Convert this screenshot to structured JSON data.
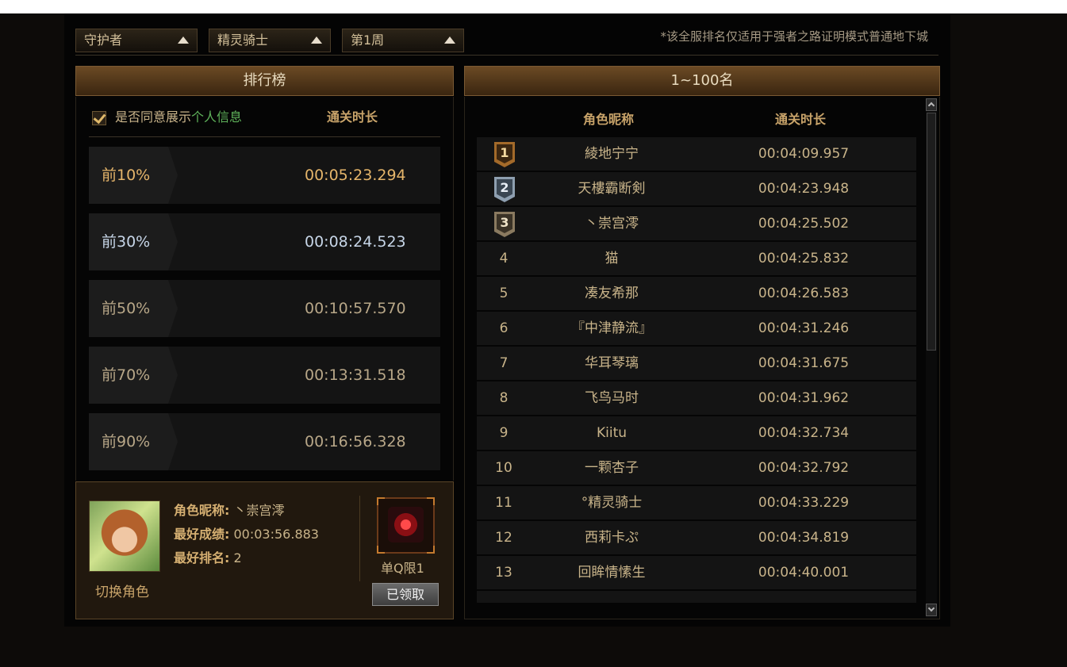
{
  "filters": {
    "class": "守护者",
    "subclass": "精灵骑士",
    "week": "第1周"
  },
  "notice": "*该全服排名仅适用于强者之路证明模式普通地下城",
  "left_panel": {
    "title": "排行榜",
    "agree_prefix": "是否同意展示",
    "agree_link": "个人信息",
    "agree_checked": true,
    "time_header": "通关时长",
    "percentiles": [
      {
        "label": "前10%",
        "time": "00:05:23.294",
        "color": "#e5b56a"
      },
      {
        "label": "前30%",
        "time": "00:08:24.523",
        "color": "#c7d6e8"
      },
      {
        "label": "前50%",
        "time": "00:10:57.570",
        "color": "#b8a788"
      },
      {
        "label": "前70%",
        "time": "00:13:31.518",
        "color": "#b8a788"
      },
      {
        "label": "前90%",
        "time": "00:16:56.328",
        "color": "#b8a788"
      }
    ]
  },
  "profile": {
    "switch_label": "切换角色",
    "name_label": "角色昵称:",
    "name_value": "丶崇宫澪",
    "best_label": "最好成绩:",
    "best_value": "00:03:56.883",
    "rank_label": "最好排名:",
    "rank_value": "2",
    "reward_label": "单Q限1",
    "claimed_label": "已领取"
  },
  "ranking": {
    "title": "1~100名",
    "name_header": "角色昵称",
    "time_header": "通关时长",
    "rows": [
      {
        "rank": "1",
        "name": "綾地宁宁",
        "time": "00:04:09.957"
      },
      {
        "rank": "2",
        "name": "天樓霸断剣",
        "time": "00:04:23.948"
      },
      {
        "rank": "3",
        "name": "丶崇宫澪",
        "time": "00:04:25.502"
      },
      {
        "rank": "4",
        "name": "猫",
        "time": "00:04:25.832"
      },
      {
        "rank": "5",
        "name": "凑友希那",
        "time": "00:04:26.583"
      },
      {
        "rank": "6",
        "name": "『中津静流』",
        "time": "00:04:31.246"
      },
      {
        "rank": "7",
        "name": "华耳琴璃",
        "time": "00:04:31.675"
      },
      {
        "rank": "8",
        "name": "飞鸟马时",
        "time": "00:04:31.962"
      },
      {
        "rank": "9",
        "name": "Kiitu",
        "time": "00:04:32.734"
      },
      {
        "rank": "10",
        "name": "一颗杏子",
        "time": "00:04:32.792"
      },
      {
        "rank": "11",
        "name": "°精灵骑士",
        "time": "00:04:33.229"
      },
      {
        "rank": "12",
        "name": "西莉卡ぷ",
        "time": "00:04:34.819"
      },
      {
        "rank": "13",
        "name": "回眸情愫生",
        "time": "00:04:40.001"
      }
    ]
  }
}
